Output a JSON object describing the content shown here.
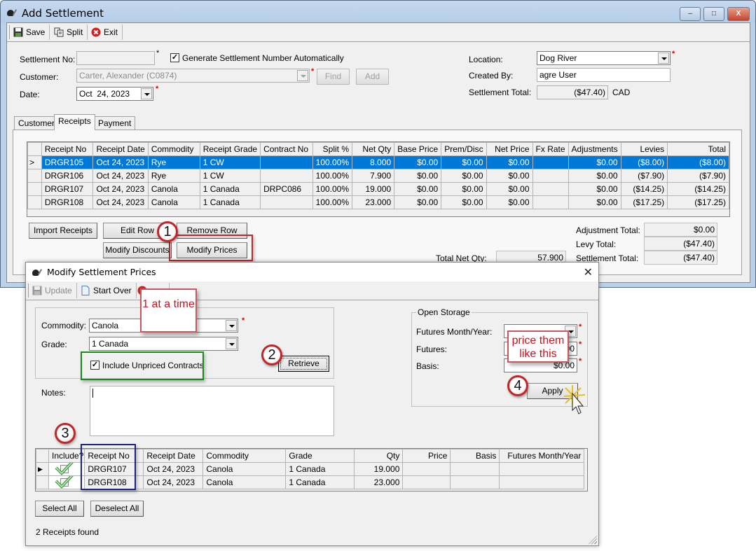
{
  "main_window": {
    "title": "Add Settlement",
    "controls": {
      "minimize": "–",
      "maximize": "□",
      "close": "X"
    },
    "toolbar": {
      "save": "Save",
      "split": "Split",
      "exit": "Exit"
    },
    "form": {
      "settlement_no_label": "Settlement No:",
      "settlement_no_value": "",
      "generate_auto_label": "Generate Settlement Number Automatically",
      "generate_auto_checked": true,
      "customer_label": "Customer:",
      "customer_value": "Carter, Alexander (C0874)",
      "find_label": "Find",
      "add_label": "Add",
      "date_label": "Date:",
      "date_value": "Oct  24, 2023",
      "location_label": "Location:",
      "location_value": "Dog River",
      "created_by_label": "Created By:",
      "created_by_value": "agre User",
      "settlement_total_label": "Settlement Total:",
      "settlement_total_value": "($47.40)",
      "currency": "CAD"
    },
    "tabs": [
      {
        "label": "Customer",
        "active": false
      },
      {
        "label": "Receipts",
        "active": true
      },
      {
        "label": "Payment",
        "active": false
      }
    ],
    "receipts_grid": {
      "columns": [
        "Receipt No",
        "Receipt Date",
        "Commodity",
        "Receipt Grade",
        "Contract No",
        "Split %",
        "Net Qty",
        "Base Price",
        "Prem/Disc",
        "Net Price",
        "Fx Rate",
        "Adjustments",
        "Levies",
        "Total"
      ],
      "rows": [
        {
          "marker": ">",
          "selected": true,
          "cells": [
            "DRGR105",
            "Oct 24, 2023",
            "Rye",
            "1 CW",
            "",
            "100.00%",
            "8.000",
            "$0.00",
            "$0.00",
            "$0.00",
            "",
            "$0.00",
            "($8.00)",
            "($8.00)"
          ]
        },
        {
          "marker": "",
          "selected": false,
          "cells": [
            "DRGR106",
            "Oct 24, 2023",
            "Rye",
            "1 CW",
            "",
            "100.00%",
            "7.900",
            "$0.00",
            "$0.00",
            "$0.00",
            "",
            "$0.00",
            "($7.90)",
            "($7.90)"
          ]
        },
        {
          "marker": "",
          "selected": false,
          "cells": [
            "DRGR107",
            "Oct 24, 2023",
            "Canola",
            "1 Canada",
            "DRPC086",
            "100.00%",
            "19.000",
            "$0.00",
            "$0.00",
            "$0.00",
            "",
            "$0.00",
            "($14.25)",
            "($14.25)"
          ]
        },
        {
          "marker": "",
          "selected": false,
          "cells": [
            "DRGR108",
            "Oct 24, 2023",
            "Canola",
            "1 Canada",
            "",
            "100.00%",
            "23.000",
            "$0.00",
            "$0.00",
            "$0.00",
            "",
            "$0.00",
            "($17.25)",
            "($17.25)"
          ]
        }
      ]
    },
    "buttons": {
      "import_receipts": "Import Receipts",
      "edit_row": "Edit Row",
      "remove_row": "Remove Row",
      "modify_discounts": "Modify Discounts",
      "modify_prices": "Modify Prices"
    },
    "totals": {
      "total_net_qty_label": "Total Net Qty:",
      "total_net_qty_value": "57.900",
      "adjustment_total_label": "Adjustment Total:",
      "adjustment_total_value": "$0.00",
      "levy_total_label": "Levy Total:",
      "levy_total_value": "($47.40)",
      "settlement_total_label": "Settlement Total:",
      "settlement_total_value": "($47.40)"
    }
  },
  "dialog": {
    "title": "Modify Settlement Prices",
    "close": "✕",
    "toolbar": {
      "update": "Update",
      "start_over": "Start Over"
    },
    "commodity_label": "Commodity:",
    "commodity_value": "Canola",
    "grade_label": "Grade:",
    "grade_value": "1 Canada",
    "include_unpriced_label": "Include Unpriced Contracts",
    "include_unpriced_checked": true,
    "retrieve_label": "Retrieve",
    "notes_label": "Notes:",
    "notes_value": "",
    "open_storage": {
      "legend": "Open Storage",
      "futures_month_label": "Futures Month/Year:",
      "futures_month_value": "",
      "futures_label": "Futures:",
      "futures_value": "0.00",
      "basis_label": "Basis:",
      "basis_value": "$0.00",
      "apply_label": "Apply"
    },
    "grid": {
      "columns": [
        "Include?",
        "Receipt No",
        "Receipt Date",
        "Commodity",
        "Grade",
        "Qty",
        "Price",
        "Basis",
        "Futures Month/Year"
      ],
      "rows": [
        {
          "marker": "▶",
          "include": true,
          "cells": [
            "DRGR107",
            "Oct 24, 2023",
            "Canola",
            "1 Canada",
            "19.000",
            "",
            "",
            ""
          ]
        },
        {
          "marker": "",
          "include": true,
          "cells": [
            "DRGR108",
            "Oct 24, 2023",
            "Canola",
            "1 Canada",
            "23.000",
            "",
            "",
            ""
          ]
        }
      ]
    },
    "select_all": "Select All",
    "deselect_all": "Deselect All",
    "status": "2 Receipts found"
  },
  "annotations": {
    "step1": "1",
    "step2": "2",
    "step3": "3",
    "step4": "4",
    "callout_one_at_a_time": "1 at a time",
    "callout_price_them": "price them like this",
    "colors": {
      "red": "#c0252a",
      "green": "#1b8a1b",
      "blue": "#1a237e",
      "selection": "#0078d7"
    }
  }
}
